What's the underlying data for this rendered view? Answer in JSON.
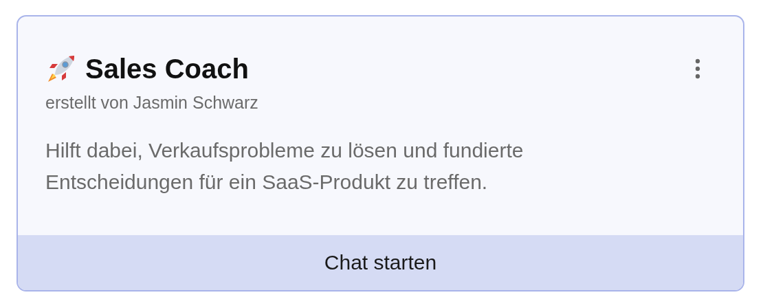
{
  "card": {
    "title": "Sales Coach",
    "author": "erstellt von Jasmin Schwarz",
    "description": "Hilft dabei, Verkaufsprobleme zu lösen und fundierte Entscheidungen für ein SaaS-Produkt zu treffen.",
    "action": "Chat starten"
  }
}
